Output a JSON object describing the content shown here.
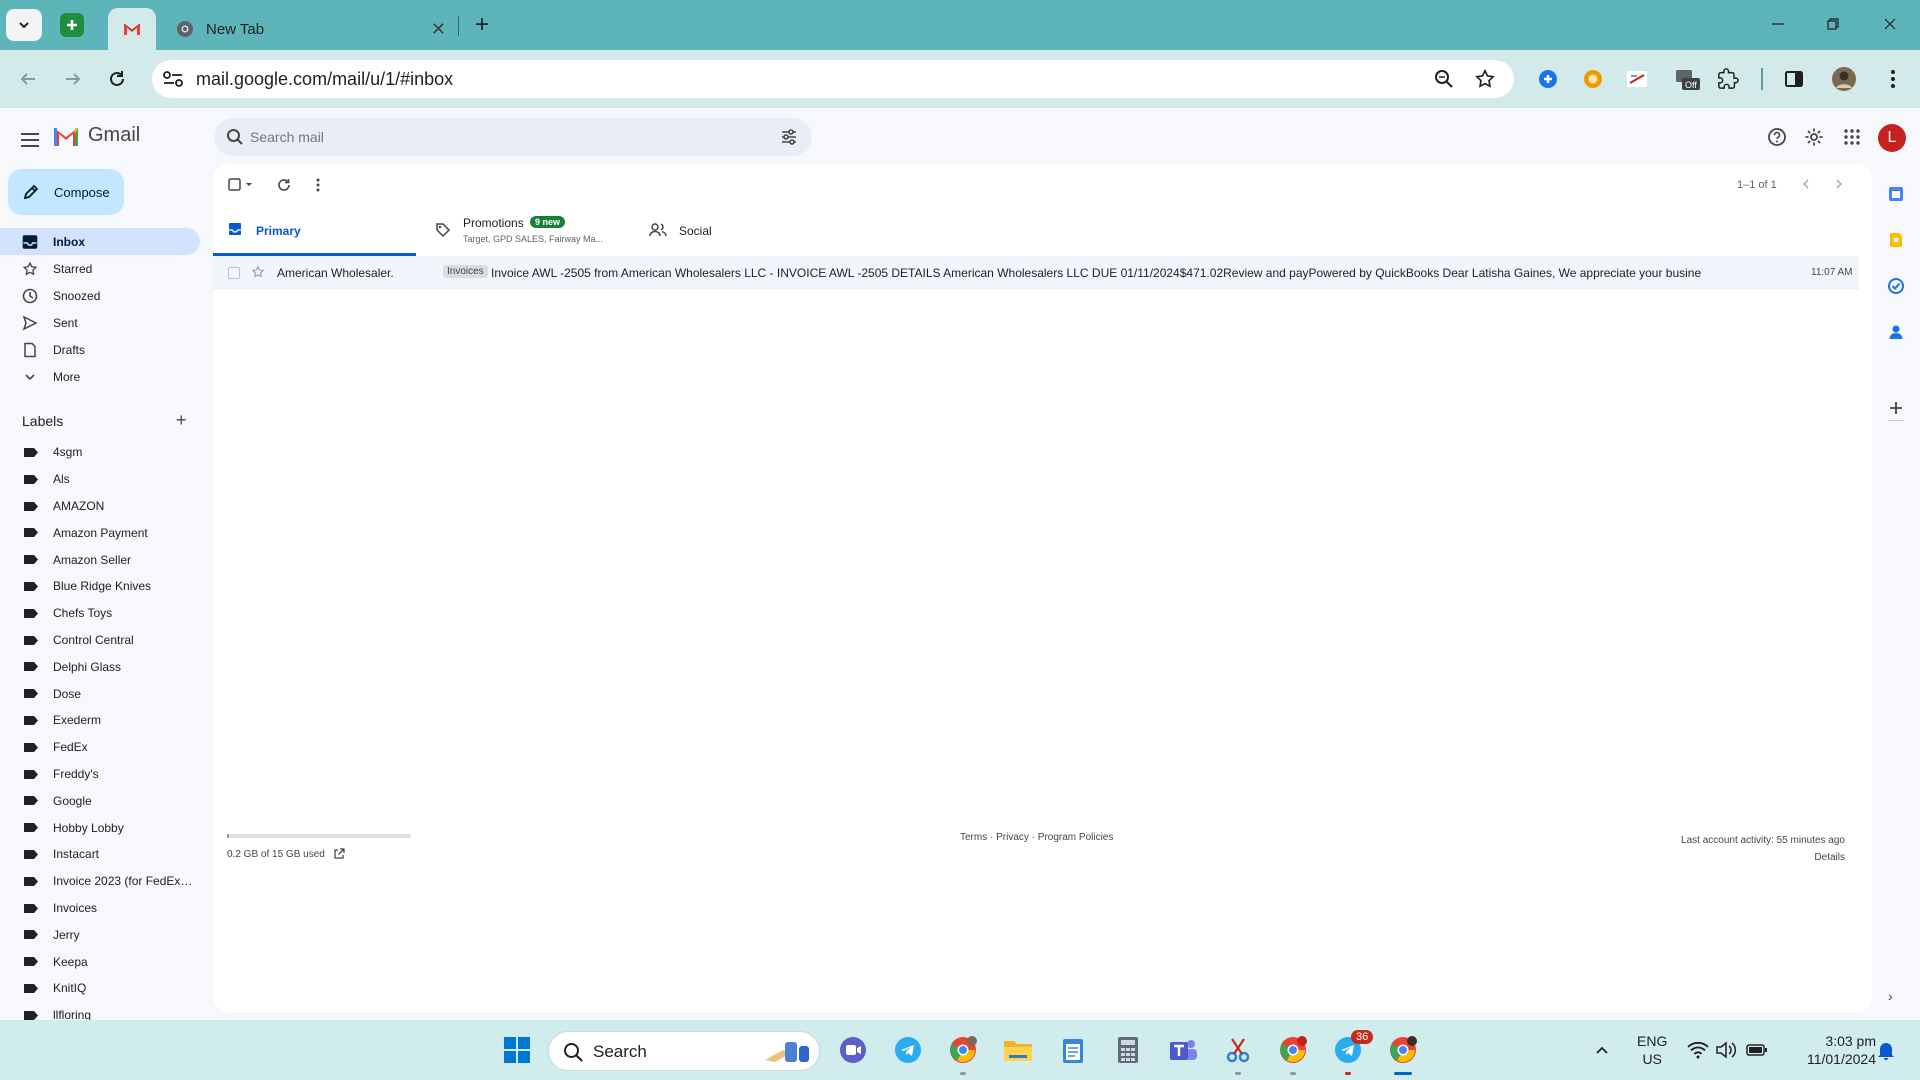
{
  "browser": {
    "tabs": [
      {
        "title": ""
      },
      {
        "title": "New Tab",
        "close": "✕"
      }
    ],
    "new_tab": "+",
    "url": "mail.google.com/mail/u/1/#inbox"
  },
  "gmail": {
    "brand": "Gmail",
    "search_placeholder": "Search mail",
    "avatar_initial": "L",
    "compose_label": "Compose",
    "nav": [
      {
        "label": "Inbox",
        "icon": "inbox-icon"
      },
      {
        "label": "Starred",
        "icon": "star-icon"
      },
      {
        "label": "Snoozed",
        "icon": "clock-icon"
      },
      {
        "label": "Sent",
        "icon": "send-icon"
      },
      {
        "label": "Drafts",
        "icon": "draft-icon"
      },
      {
        "label": "More",
        "icon": "chevron-down-icon"
      }
    ],
    "labels_title": "Labels",
    "labels_add": "+",
    "labels": [
      "4sgm",
      "Als",
      "AMAZON",
      "Amazon Payment",
      "Amazon Seller",
      "Blue Ridge Knives",
      "Chefs Toys",
      "Control Central",
      "Delphi Glass",
      "Dose",
      "Exederm",
      "FedEx",
      "Freddy's",
      "Google",
      "Hobby Lobby",
      "Instacart",
      "Invoice 2023 (for FedEx ...",
      "Invoices",
      "Jerry",
      "Keepa",
      "KnitIQ",
      "llfloring"
    ],
    "pager": "1–1 of 1",
    "tabs": {
      "primary": "Primary",
      "promotions": "Promotions",
      "promotions_badge": "9 new",
      "promotions_sub": "Target, GPD SALES, Fairway Ma...",
      "social": "Social"
    },
    "emails": [
      {
        "sender": "American Wholesaler.",
        "tag": "Invoices",
        "subject": "Invoice AWL -2505 from American Wholesalers LLC - INVOICE AWL -2505 DETAILS American Wholesalers LLC DUE 01/11/2024$471.02Review and payPowered by QuickBooks Dear Latisha Gaines, We appreciate your business. Pl",
        "time": "11:07 AM"
      }
    ],
    "storage_text": "0.2 GB of 15 GB used",
    "storage_fraction": 0.013,
    "footer_links": "Terms · Privacy · Program Policies",
    "last_activity": "Last account activity: 55 minutes ago",
    "details": "Details",
    "collapse": "›"
  },
  "taskbar": {
    "search_label": "Search",
    "telegram_badge": "36",
    "lang_line1": "ENG",
    "lang_line2": "US",
    "time": "3:03 pm",
    "date": "11/01/2024"
  },
  "colors": {
    "tabstrip": "#5eb5b9",
    "toolbar": "#d3eaea",
    "accent": "#0b57d0",
    "compose": "#c2e7ff",
    "badge_green": "#188038"
  }
}
